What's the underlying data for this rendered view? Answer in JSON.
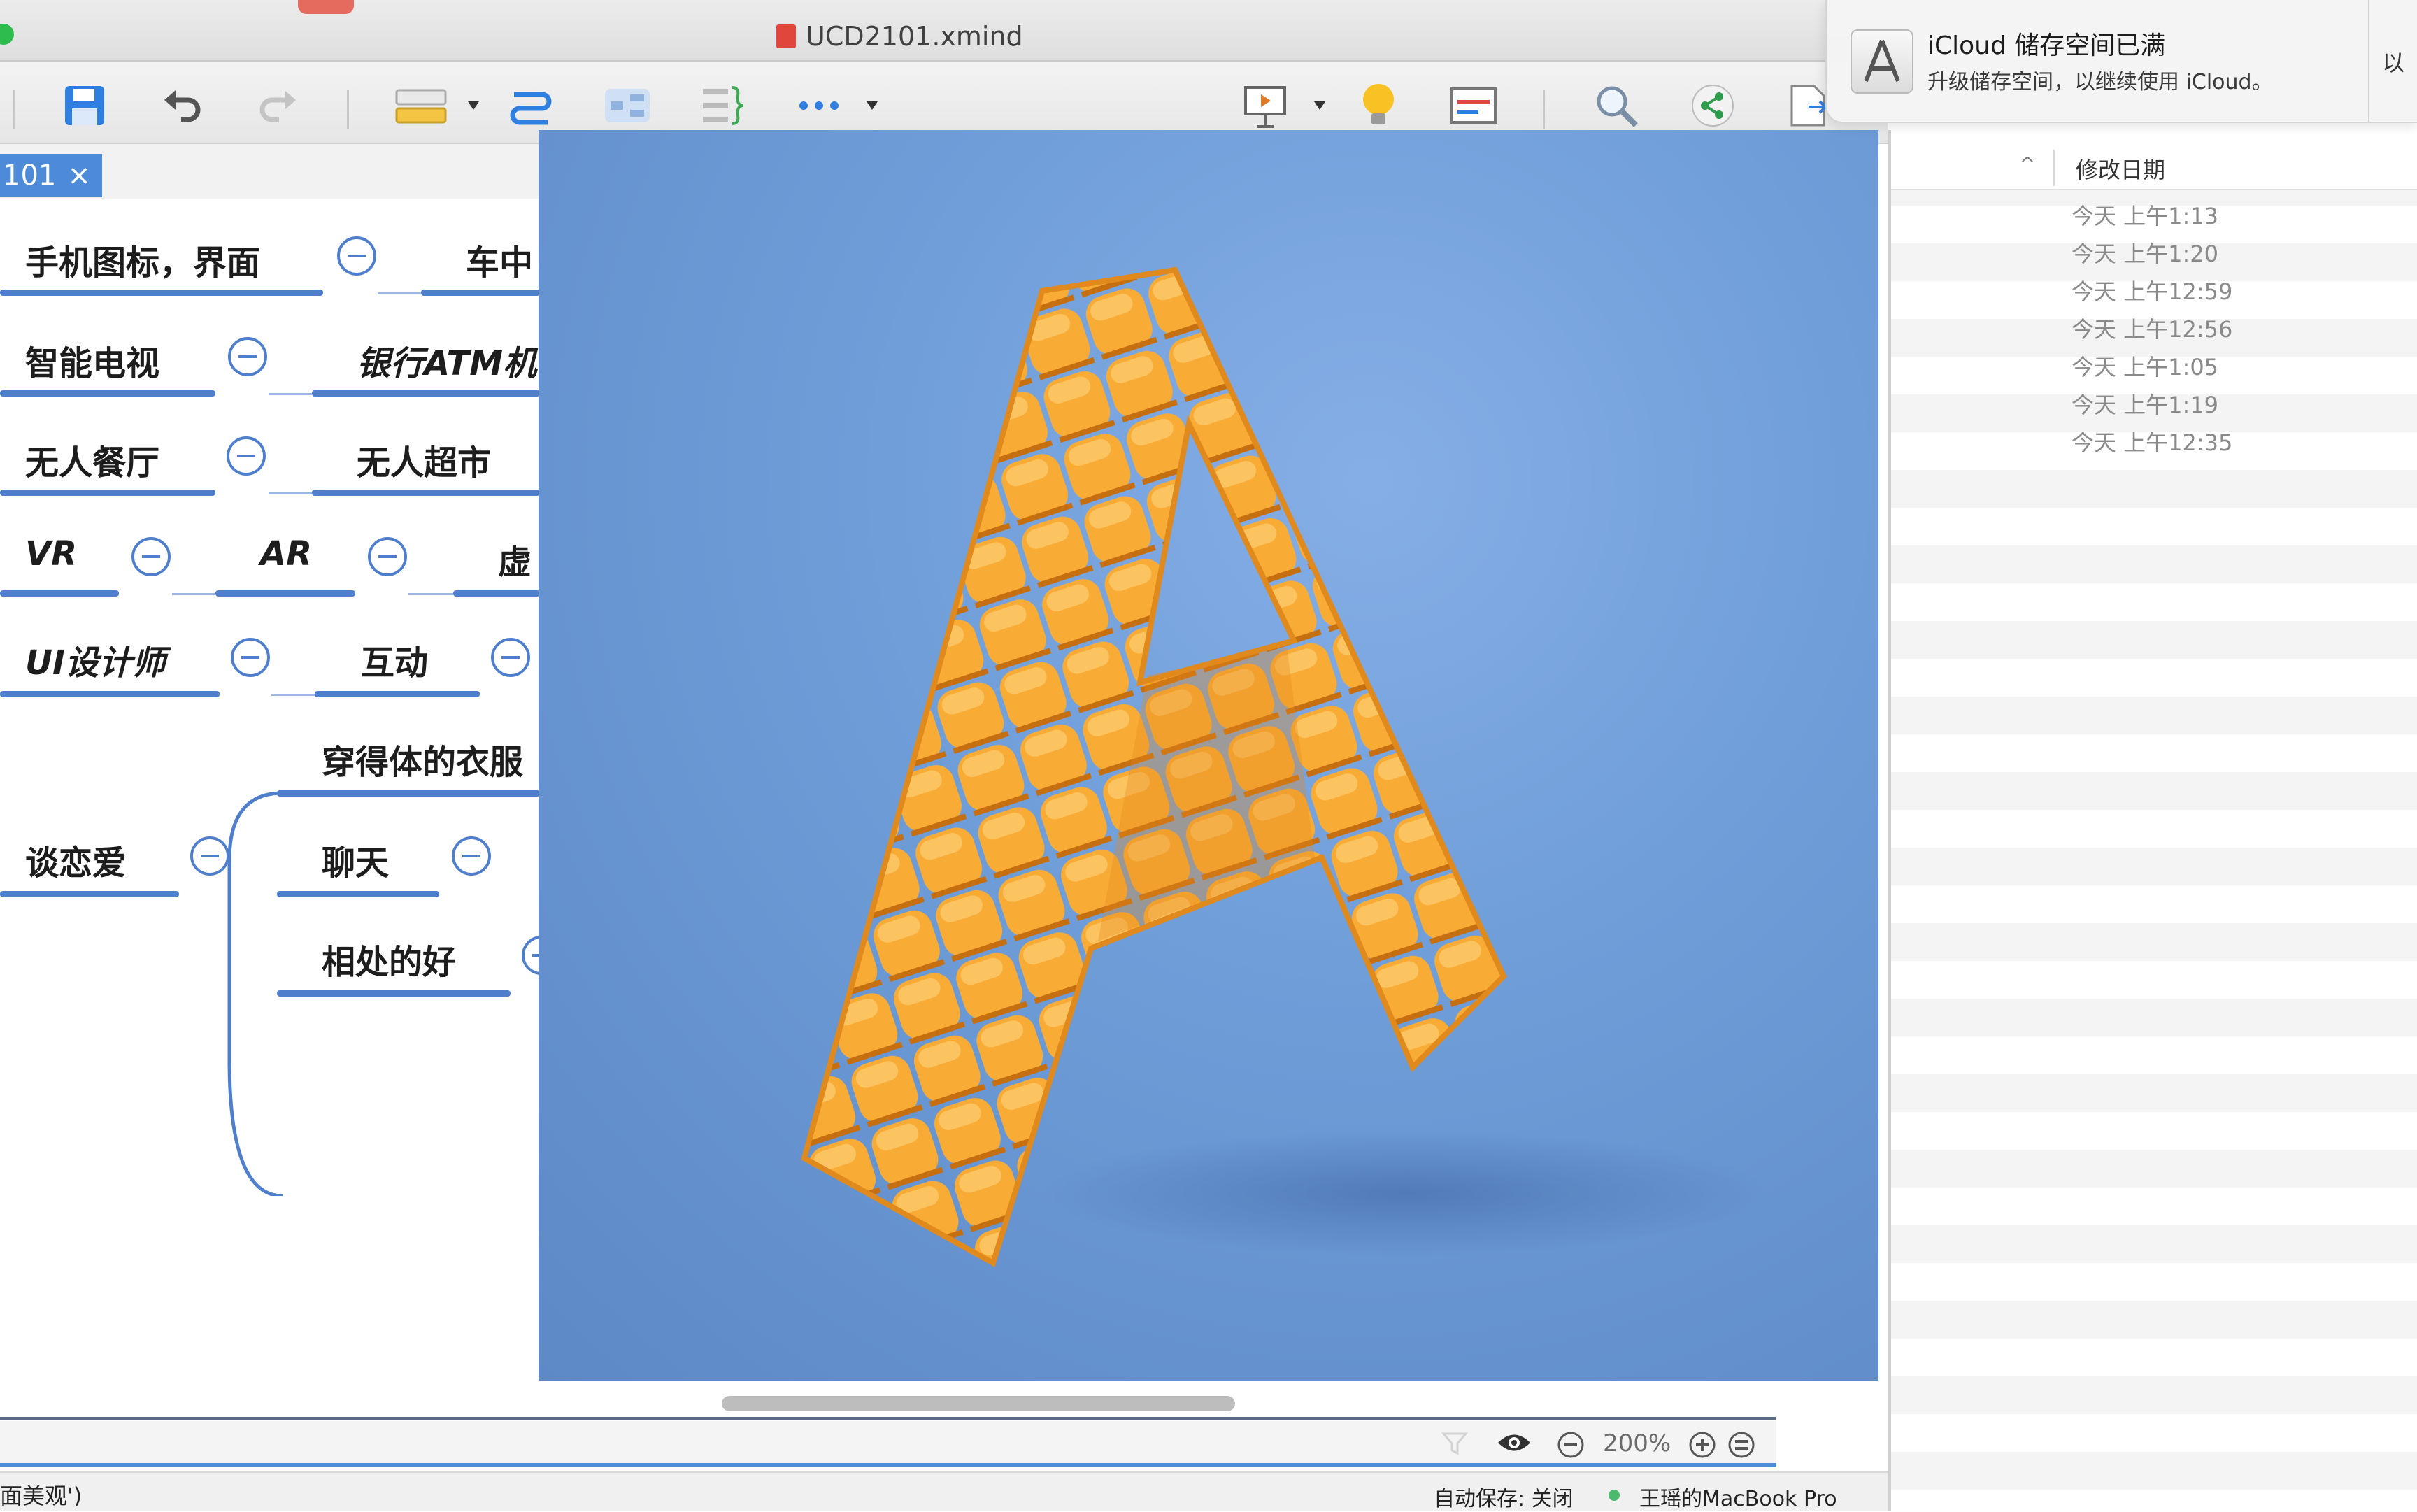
{
  "window": {
    "title": "UCD2101.xmind"
  },
  "tab": {
    "label": "101",
    "close": "×"
  },
  "mindmap": {
    "row1": [
      "手机图标，界面",
      "车中"
    ],
    "row2": [
      "智能电视",
      "银行ATM机"
    ],
    "row3": [
      "无人餐厅",
      "无人超市"
    ],
    "row4": [
      "VR",
      "AR",
      "虚"
    ],
    "row5": [
      "UI设计师",
      "互动"
    ],
    "romance": {
      "root": "谈恋爱",
      "children": [
        "穿得体的衣服",
        "聊天",
        "相处的好"
      ]
    }
  },
  "zoom": {
    "level": "200%"
  },
  "status": {
    "left": "面美观')",
    "autosave": "自动保存: 关闭",
    "device": "王瑶的MacBook Pro"
  },
  "finder": {
    "column_title": "修改日期",
    "dates": [
      "今天 上午1:13",
      "今天 上午1:20",
      "今天 上午12:59",
      "今天 上午12:56",
      "今天 上午1:05",
      "今天 上午1:19",
      "今天 上午12:35"
    ]
  },
  "notification": {
    "title": "iCloud 储存空间已满",
    "body": "升级储存空间，以继续使用 iCloud。",
    "action": "以"
  },
  "colors": {
    "accent": "#4d8ad8",
    "line": "#4f7fcc",
    "photo_bg": "#6e9dd8",
    "letter": "#f7a429"
  },
  "icons": [
    "save-icon",
    "undo-icon",
    "redo-icon",
    "style-icon",
    "relationship-icon",
    "structure-icon",
    "summary-icon",
    "more-icon",
    "presentation-icon",
    "idea-icon",
    "outline-icon",
    "search-icon",
    "share-icon",
    "export-icon",
    "filter-icon",
    "eye-icon",
    "zoom-out-icon",
    "zoom-in-icon",
    "fit-icon"
  ]
}
